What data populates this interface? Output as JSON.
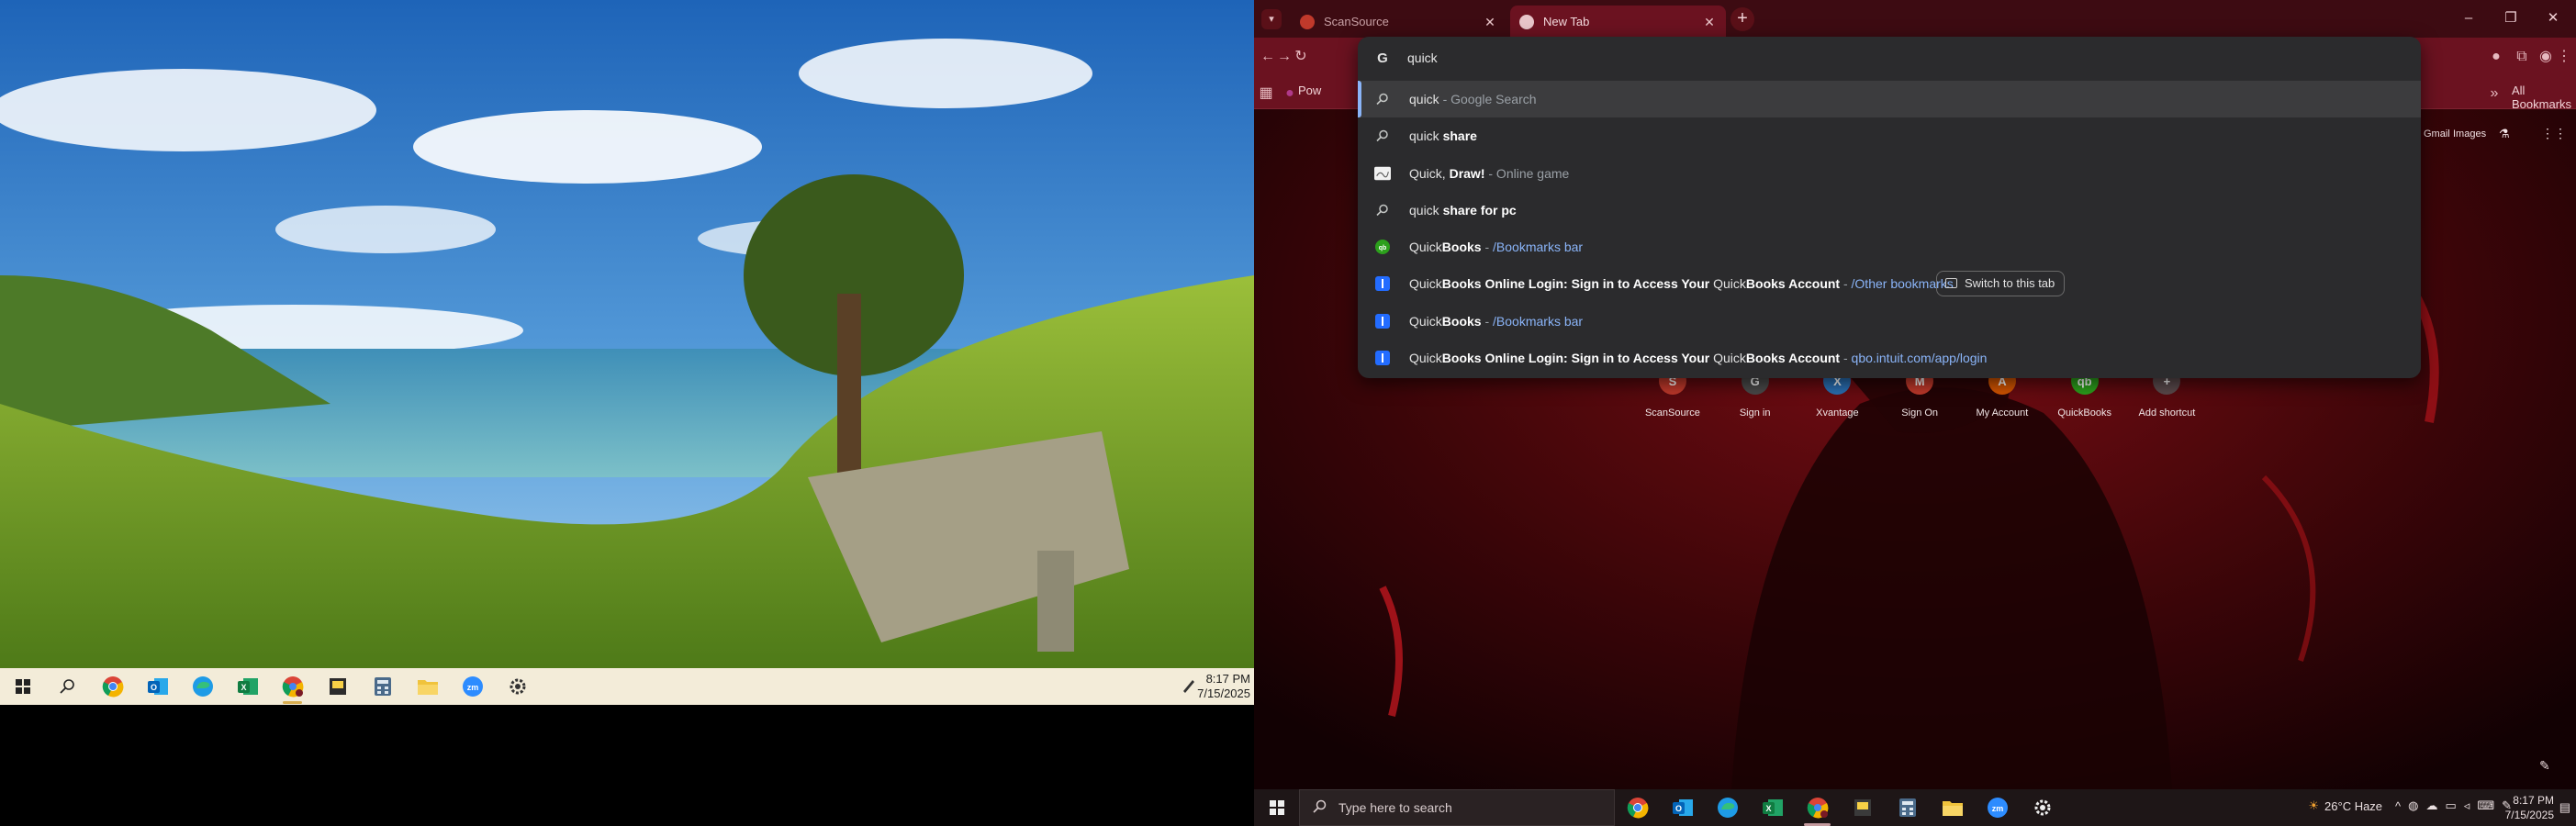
{
  "left_taskbar": {
    "apps": [
      "start-icon",
      "search-icon",
      "chrome-icon",
      "outlook-icon",
      "edge-icon",
      "excel-icon",
      "chrome-profile-icon",
      "sticky-notes-icon",
      "calculator-icon",
      "file-explorer-icon",
      "zoom-icon",
      "settings-icon"
    ],
    "time": "8:17 PM",
    "date": "7/15/2025"
  },
  "browser": {
    "tabs": [
      {
        "label": "ScanSource",
        "active": false
      },
      {
        "label": "New Tab",
        "active": true
      }
    ],
    "bookmarks_bar": {
      "first_item_label": "Pow",
      "all_bookmarks_label": "All Bookmarks"
    },
    "omnibox": {
      "query": "quick ",
      "suggestions": [
        {
          "icon": "search-icon",
          "parts": [
            {
              "t": "quick",
              "s": "n"
            },
            {
              "t": " - Google Search",
              "s": "dim"
            }
          ],
          "selected": true
        },
        {
          "icon": "search-icon",
          "parts": [
            {
              "t": "quick ",
              "s": "n"
            },
            {
              "t": "share",
              "s": "b"
            }
          ]
        },
        {
          "icon": "quickdraw-icon",
          "parts": [
            {
              "t": "Quick, ",
              "s": "n"
            },
            {
              "t": "Draw!",
              "s": "b"
            },
            {
              "t": " - Online game",
              "s": "dim"
            }
          ]
        },
        {
          "icon": "search-icon",
          "parts": [
            {
              "t": "quick ",
              "s": "n"
            },
            {
              "t": "share for pc",
              "s": "b"
            }
          ]
        },
        {
          "icon": "quickbooks-icon",
          "parts": [
            {
              "t": "Quick",
              "s": "n"
            },
            {
              "t": "Books",
              "s": "b"
            },
            {
              "t": " - ",
              "s": "dim"
            },
            {
              "t": "/Bookmarks bar",
              "s": "url"
            }
          ]
        },
        {
          "icon": "intuit-icon",
          "parts": [
            {
              "t": "Quick",
              "s": "n"
            },
            {
              "t": "Books Online Login: Sign in to Access Your ",
              "s": "b"
            },
            {
              "t": "Quick",
              "s": "n"
            },
            {
              "t": "Books Account",
              "s": "b"
            },
            {
              "t": " - ",
              "s": "dim"
            },
            {
              "t": "/Other bookmarks",
              "s": "url"
            }
          ],
          "switch_tab": "Switch to this tab"
        },
        {
          "icon": "intuit-icon",
          "parts": [
            {
              "t": "Quick",
              "s": "n"
            },
            {
              "t": "Books",
              "s": "b"
            },
            {
              "t": " - ",
              "s": "dim"
            },
            {
              "t": "/Bookmarks bar",
              "s": "url"
            }
          ]
        },
        {
          "icon": "intuit-icon",
          "parts": [
            {
              "t": "Quick",
              "s": "n"
            },
            {
              "t": "Books Online Login: Sign in to Access Your ",
              "s": "b"
            },
            {
              "t": "Quick",
              "s": "n"
            },
            {
              "t": "Books Account",
              "s": "b"
            },
            {
              "t": " - ",
              "s": "dim"
            },
            {
              "t": "qbo.intuit.com/app/login",
              "s": "url"
            }
          ]
        }
      ]
    }
  },
  "new_tab": {
    "header_links": {
      "gmail": "Gmail",
      "images": "Images"
    },
    "shortcuts": [
      {
        "label": "ScanSource",
        "icon_text": "S",
        "color": "#c0392b"
      },
      {
        "label": "Sign in",
        "icon_text": "G",
        "color": "#4a4a4a"
      },
      {
        "label": "Xvantage",
        "icon_text": "X",
        "color": "#2a6fb3"
      },
      {
        "label": "Sign On",
        "icon_text": "M",
        "color": "#c0392b"
      },
      {
        "label": "My Account",
        "icon_text": "A",
        "color": "#d35400"
      },
      {
        "label": "QuickBooks",
        "icon_text": "qb",
        "color": "#2ca01c"
      },
      {
        "label": "Add shortcut",
        "icon_text": "+",
        "color": "#5b4a4c"
      }
    ]
  },
  "right_taskbar": {
    "search_placeholder": "Type here to search",
    "weather": "26°C  Haze",
    "time": "8:17 PM",
    "date": "7/15/2025"
  },
  "colors": {
    "chrome_frame": "#3d0b12",
    "chrome_toolbar": "#6b1220",
    "omnibox_bg": "#2b2b2d",
    "link_blue": "#8ab4f8",
    "left_taskbar": "#f3ecd9"
  }
}
